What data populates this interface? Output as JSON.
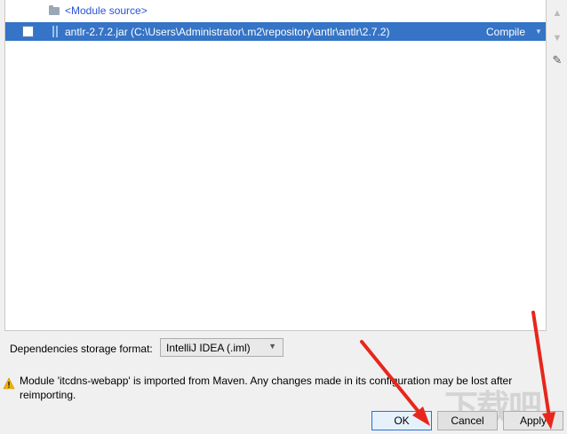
{
  "dependencies": {
    "module_source_label": "<Module source>",
    "rows": [
      {
        "label": "antlr-2.7.2.jar (C:\\Users\\Administrator\\.m2\\repository\\antlr\\antlr\\2.7.2)",
        "scope": "Compile",
        "selected": true
      }
    ]
  },
  "toolbar": {
    "add_icon": "plus-icon",
    "remove_icon": "minus-icon",
    "up_icon": "arrow-up-icon",
    "down_icon": "arrow-down-icon",
    "edit_icon": "pencil-icon"
  },
  "storage": {
    "label": "Dependencies storage format:",
    "selected": "IntelliJ IDEA (.iml)"
  },
  "warning": {
    "text": "Module 'itcdns-webapp' is imported from Maven. Any changes made in its configuration may be lost after reimporting."
  },
  "buttons": {
    "ok": "OK",
    "cancel": "Cancel",
    "apply": "Apply"
  },
  "colors": {
    "selection": "#3574c6",
    "link": "#2a54d8",
    "annotation_arrow": "#e8261c"
  }
}
